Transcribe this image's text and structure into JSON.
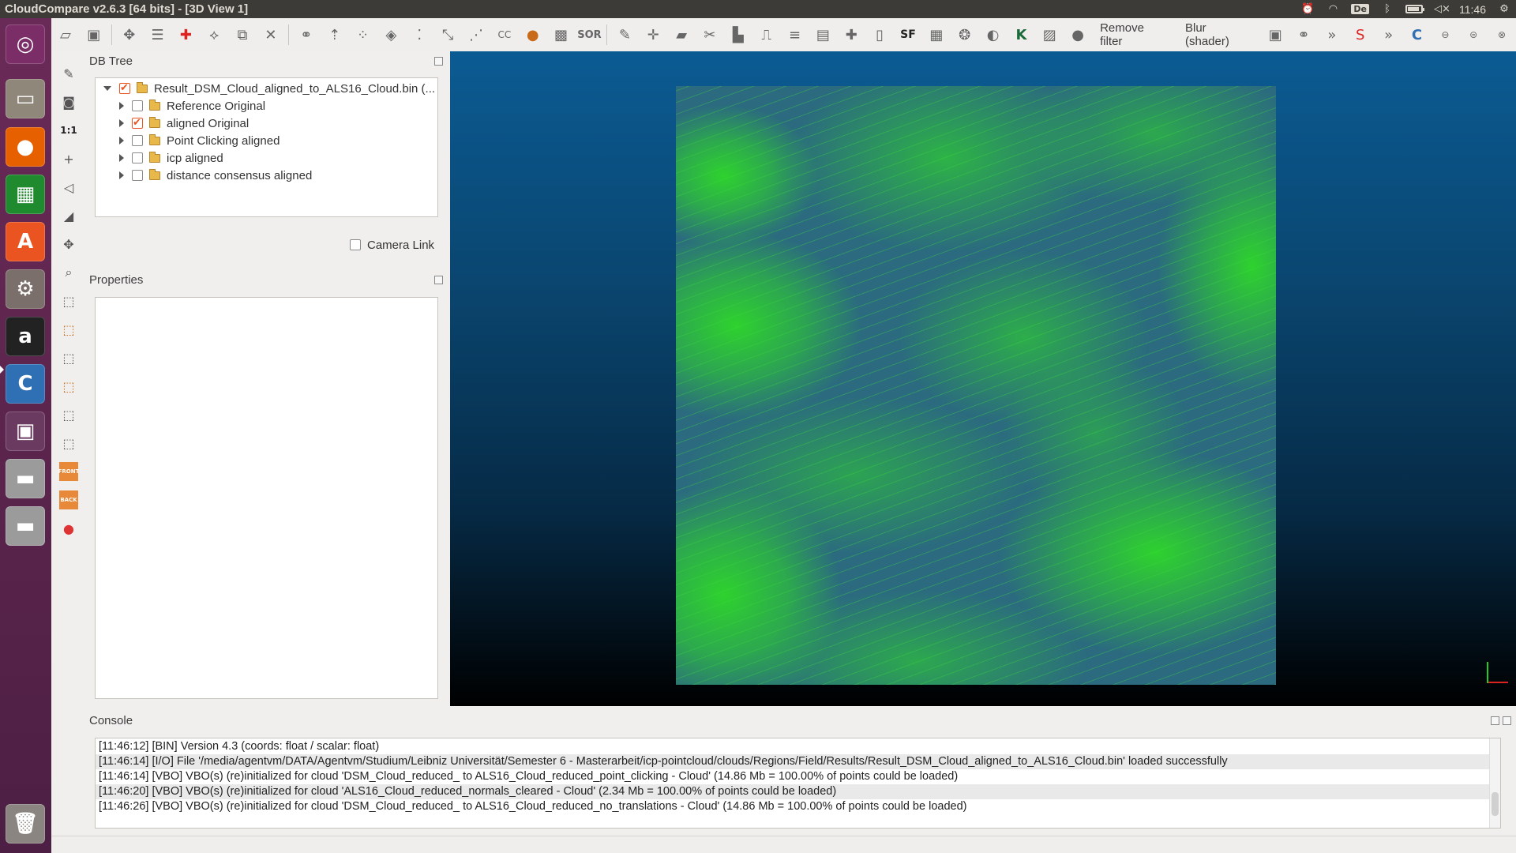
{
  "window": {
    "title": "CloudCompare v2.6.3 [64 bits] - [3D View 1]"
  },
  "tray": {
    "keyboard": "De",
    "time": "11:46",
    "battery_level": 0.85
  },
  "launcher": {
    "items": [
      {
        "name": "ubuntu-dash",
        "glyph": "◎",
        "color": "#7a2d66"
      },
      {
        "name": "files",
        "glyph": "▭",
        "color": "#8f8779"
      },
      {
        "name": "firefox",
        "glyph": "●",
        "color": "#e66000"
      },
      {
        "name": "libreoffice-calc",
        "glyph": "▦",
        "color": "#1f8a2e"
      },
      {
        "name": "software-center",
        "glyph": "A",
        "color": "#e95420"
      },
      {
        "name": "system-settings",
        "glyph": "⚙",
        "color": "#7a6f6a"
      },
      {
        "name": "amazon",
        "glyph": "a",
        "color": "#222222"
      },
      {
        "name": "cloudcompare",
        "glyph": "C",
        "color": "#2f6fb4"
      },
      {
        "name": "workspace-switcher",
        "glyph": "▣",
        "color": "#6a3a60"
      },
      {
        "name": "drive-1",
        "glyph": "▬",
        "color": "#9b9b9b"
      },
      {
        "name": "drive-2",
        "glyph": "▬",
        "color": "#9b9b9b"
      }
    ],
    "trash_glyph": "🗑"
  },
  "toolbar": {
    "remove_filter_label": "Remove filter",
    "blur_label": "Blur (shader)",
    "sf_label": "SF",
    "sor_label": "SOR",
    "more_glyph": "»"
  },
  "db_tree": {
    "title": "DB Tree",
    "root": {
      "label": "Result_DSM_Cloud_aligned_to_ALS16_Cloud.bin (...",
      "checked": true
    },
    "children": [
      {
        "label": "Reference Original",
        "checked": false
      },
      {
        "label": "aligned Original",
        "checked": true
      },
      {
        "label": "Point Clicking aligned",
        "checked": false
      },
      {
        "label": "icp aligned",
        "checked": false
      },
      {
        "label": "distance consensus aligned",
        "checked": false
      }
    ],
    "camera_link_label": "Camera Link"
  },
  "properties": {
    "title": "Properties"
  },
  "vtoolbar": {
    "one_to_one": "1:1",
    "front_label": "FRONT",
    "back_label": "BACK"
  },
  "console": {
    "title": "Console",
    "lines": [
      "[11:46:12] [BIN] Version 4.3 (coords: float / scalar: float)",
      "[11:46:14] [I/O] File '/media/agentvm/DATA/Agentvm/Studium/Leibniz Universität/Semester 6 - Masterarbeit/icp-pointcloud/clouds/Regions/Field/Results/Result_DSM_Cloud_aligned_to_ALS16_Cloud.bin' loaded successfully",
      "[11:46:14] [VBO] VBO(s) (re)initialized for cloud 'DSM_Cloud_reduced_ to ALS16_Cloud_reduced_point_clicking - Cloud' (14.86 Mb = 100.00% of points could be loaded)",
      "[11:46:20] [VBO] VBO(s) (re)initialized for cloud 'ALS16_Cloud_reduced_normals_cleared - Cloud' (2.34 Mb = 100.00% of points could be loaded)",
      "[11:46:26] [VBO] VBO(s) (re)initialized for cloud 'DSM_Cloud_reduced_ to ALS16_Cloud_reduced_no_translations - Cloud' (14.86 Mb = 100.00% of points could be loaded)"
    ]
  },
  "colors": {
    "view_top": "#0b5b93",
    "cloud_green": "#2ed22e",
    "cloud_blue": "#2b6a7f",
    "accent": "#e95420"
  }
}
